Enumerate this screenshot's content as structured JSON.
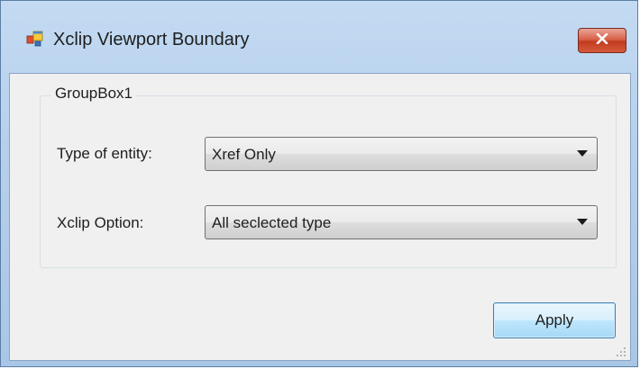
{
  "window": {
    "title": "Xclip Viewport Boundary",
    "icon": "app-window-icon",
    "close_icon": "close-icon"
  },
  "groupbox": {
    "label": "GroupBox1"
  },
  "fields": {
    "entity_type": {
      "label": "Type of entity:",
      "value": "Xref Only"
    },
    "xclip_option": {
      "label": "Xclip Option:",
      "value": "All seclected type"
    }
  },
  "buttons": {
    "apply": "Apply"
  },
  "colors": {
    "close_button": "#c94a2e",
    "titlebar": "#b9d1ea",
    "dialog_background": "#f0f0f0",
    "apply_button_border": "#3c7fb1"
  }
}
